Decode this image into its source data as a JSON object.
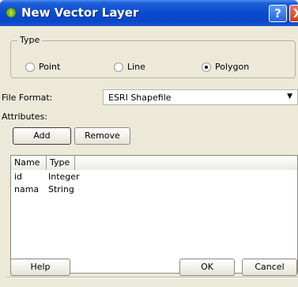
{
  "window": {
    "title": "New Vector Layer",
    "help_glyph": "?",
    "close_glyph": "X",
    "colors": {
      "titlebar": "#0a4ad0",
      "client": "#ece9d8",
      "close": "#c8401c"
    }
  },
  "type_group": {
    "title": "Type",
    "options": [
      {
        "label": "Point",
        "checked": false
      },
      {
        "label": "Line",
        "checked": false
      },
      {
        "label": "Polygon",
        "checked": true
      }
    ]
  },
  "file_format": {
    "label": "File Format:",
    "value": "ESRI Shapefile",
    "arrow": "▼"
  },
  "attributes": {
    "label": "Attributes:",
    "add_label": "Add",
    "remove_label": "Remove",
    "columns": [
      "Name",
      "Type"
    ],
    "rows": [
      {
        "name": "id",
        "type": "Integer"
      },
      {
        "name": "nama",
        "type": "String"
      }
    ]
  },
  "footer": {
    "help_label": "Help",
    "ok_label": "OK",
    "cancel_label": "Cancel"
  }
}
